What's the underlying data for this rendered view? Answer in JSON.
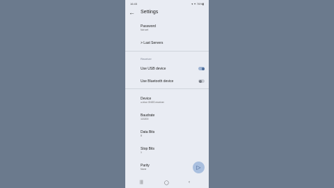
{
  "status_bar": {
    "time": "16:45",
    "icons": "▾ ✦ 76%▮"
  },
  "app_bar": {
    "back_icon": "arrow-left-icon",
    "title": "Settings"
  },
  "password": {
    "label": "Password",
    "value": "Not set"
  },
  "last_servers": {
    "label": "> Last Servers"
  },
  "section_receiver": {
    "label": "Receiver"
  },
  "use_usb": {
    "label": "Use USB device",
    "enabled": true
  },
  "use_bluetooth": {
    "label": "Use Bluetooth device",
    "enabled": false
  },
  "device": {
    "label": "Device",
    "value": "u-blox GNSS receiver"
  },
  "baudrate": {
    "label": "Baudrate",
    "value": "115200"
  },
  "data_bits": {
    "label": "Data Bits",
    "value": "8"
  },
  "stop_bits": {
    "label": "Stop Bits",
    "value": "1"
  },
  "parity": {
    "label": "Parity",
    "value": "None"
  },
  "fab": {
    "icon": "play-arrow-icon"
  },
  "nav_bar": {
    "recent": "|||",
    "home": "◯",
    "back": "‹"
  },
  "colors": {
    "background": "#6b7a8d",
    "screen": "#e9ecf3",
    "accent": "#4d6d99"
  }
}
